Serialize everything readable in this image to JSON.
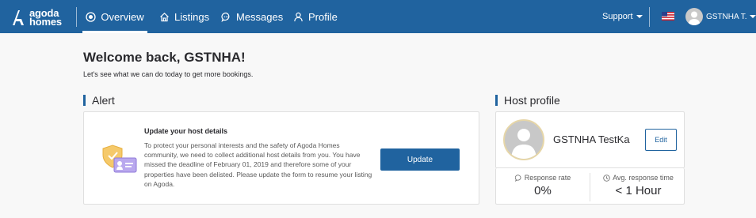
{
  "brand": {
    "line1": "agoda",
    "line2": "homes"
  },
  "nav": {
    "items": [
      {
        "label": "Overview",
        "icon": "overview-icon",
        "active": true
      },
      {
        "label": "Listings",
        "icon": "home-icon"
      },
      {
        "label": "Messages",
        "icon": "chat-icon"
      },
      {
        "label": "Profile",
        "icon": "user-icon"
      }
    ],
    "support_label": "Support",
    "flag_icon": "us-flag-icon",
    "user_name": "GSTNHA T."
  },
  "welcome": {
    "title": "Welcome back, GSTNHA!",
    "subtitle": "Let's see what we can do today to get more bookings."
  },
  "alert": {
    "section_title": "Alert",
    "title": "Update your host details",
    "body": "To protect your personal interests and the safety of Agoda Homes community, we need to collect additional host details from you. You have missed the deadline of February 01, 2019 and therefore some of your properties have been delisted. Please update the form to resume your listing on Agoda.",
    "button_label": "Update"
  },
  "host_profile": {
    "section_title": "Host profile",
    "name": "GSTNHA TestKa",
    "edit_label": "Edit",
    "response_rate_label": "Response rate",
    "response_rate_value": "0%",
    "avg_response_label": "Avg. response time",
    "avg_response_value": "< 1 Hour"
  },
  "colors": {
    "nav_bg": "#20639f",
    "accent": "#20639f",
    "page_bg": "#f8f8f8"
  }
}
